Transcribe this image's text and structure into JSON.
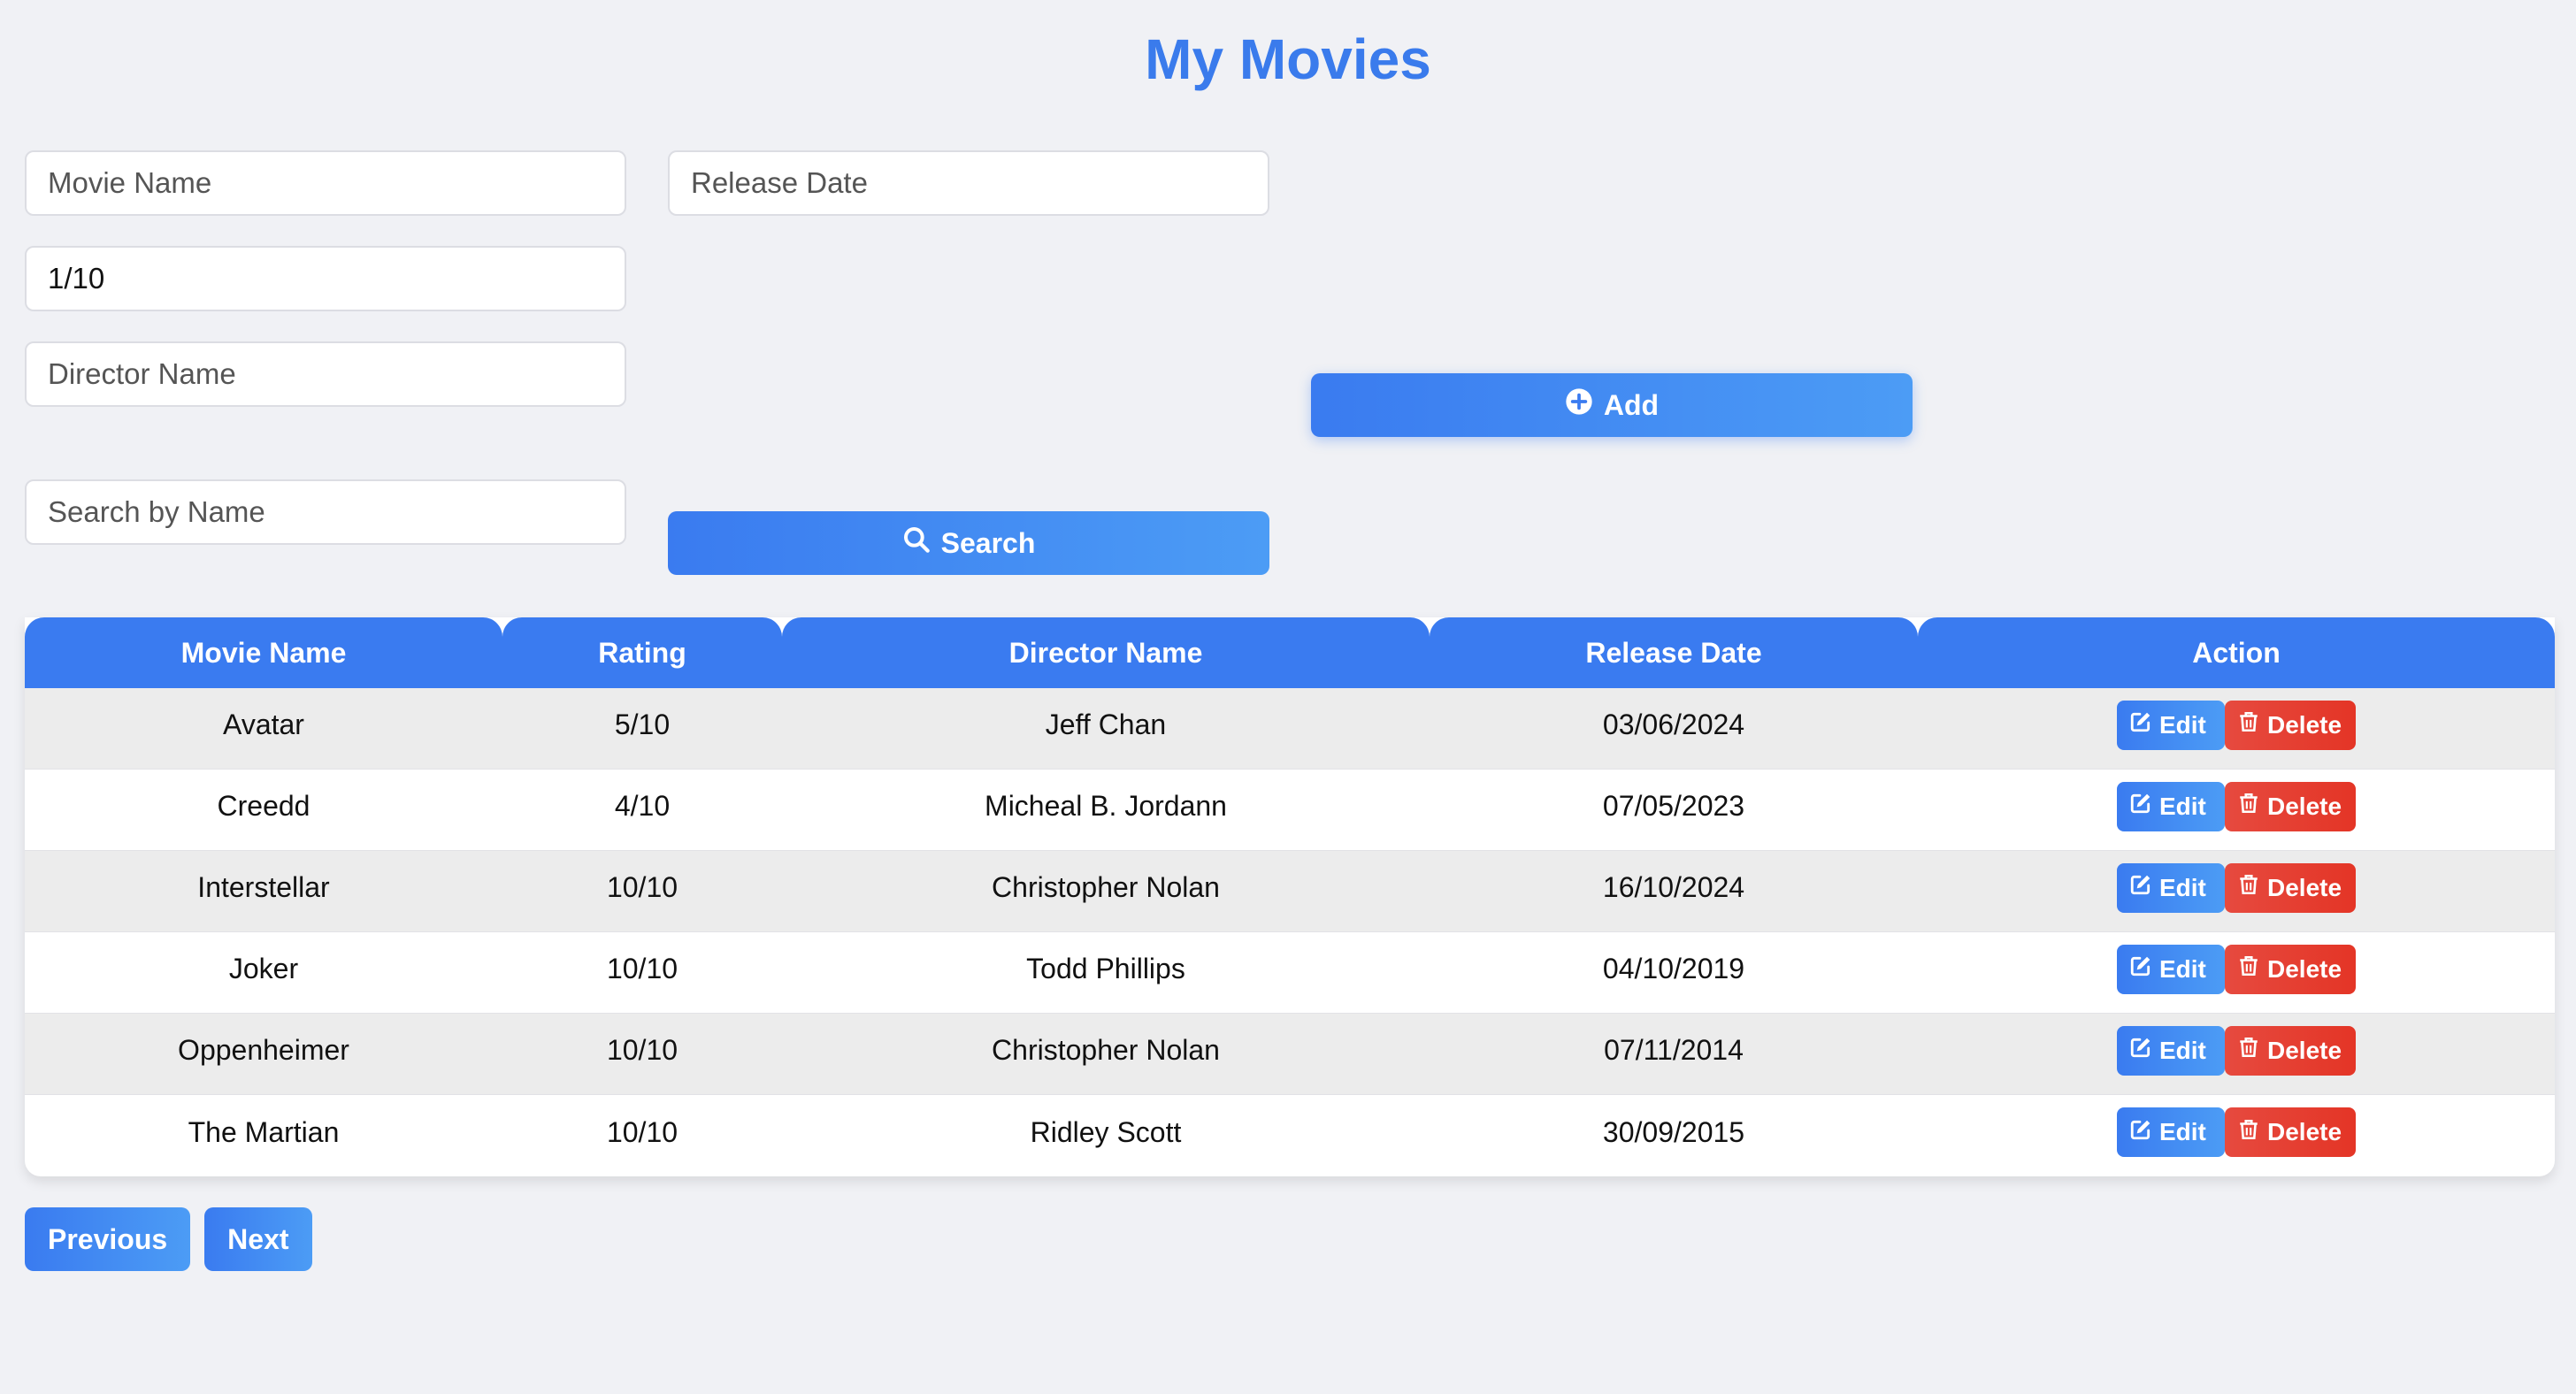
{
  "page": {
    "title": "My Movies"
  },
  "form": {
    "movie_name_placeholder": "Movie Name",
    "release_date_placeholder": "Release Date",
    "rating_value": "1/10",
    "director_placeholder": "Director Name",
    "add_label": "Add",
    "search_placeholder": "Search by Name",
    "search_label": "Search"
  },
  "table": {
    "headers": [
      "Movie Name",
      "Rating",
      "Director Name",
      "Release Date",
      "Action"
    ],
    "rows": [
      [
        "Avatar",
        "5/10",
        "Jeff Chan",
        "03/06/2024"
      ],
      [
        "Creedd",
        "4/10",
        "Micheal B. Jordann",
        "07/05/2023"
      ],
      [
        "Interstellar",
        "10/10",
        "Christopher Nolan",
        "16/10/2024"
      ],
      [
        "Joker",
        "10/10",
        "Todd Phillips",
        "04/10/2019"
      ],
      [
        "Oppenheimer",
        "10/10",
        "Christopher Nolan",
        "07/11/2014"
      ],
      [
        "The Martian",
        "10/10",
        "Ridley Scott",
        "30/09/2015"
      ]
    ],
    "edit_label": "Edit",
    "delete_label": "Delete"
  },
  "pagination": {
    "previous_label": "Previous",
    "next_label": "Next"
  },
  "colors": {
    "primary": "#3a7bf0",
    "danger": "#e43526",
    "background": "#f0f1f5"
  }
}
